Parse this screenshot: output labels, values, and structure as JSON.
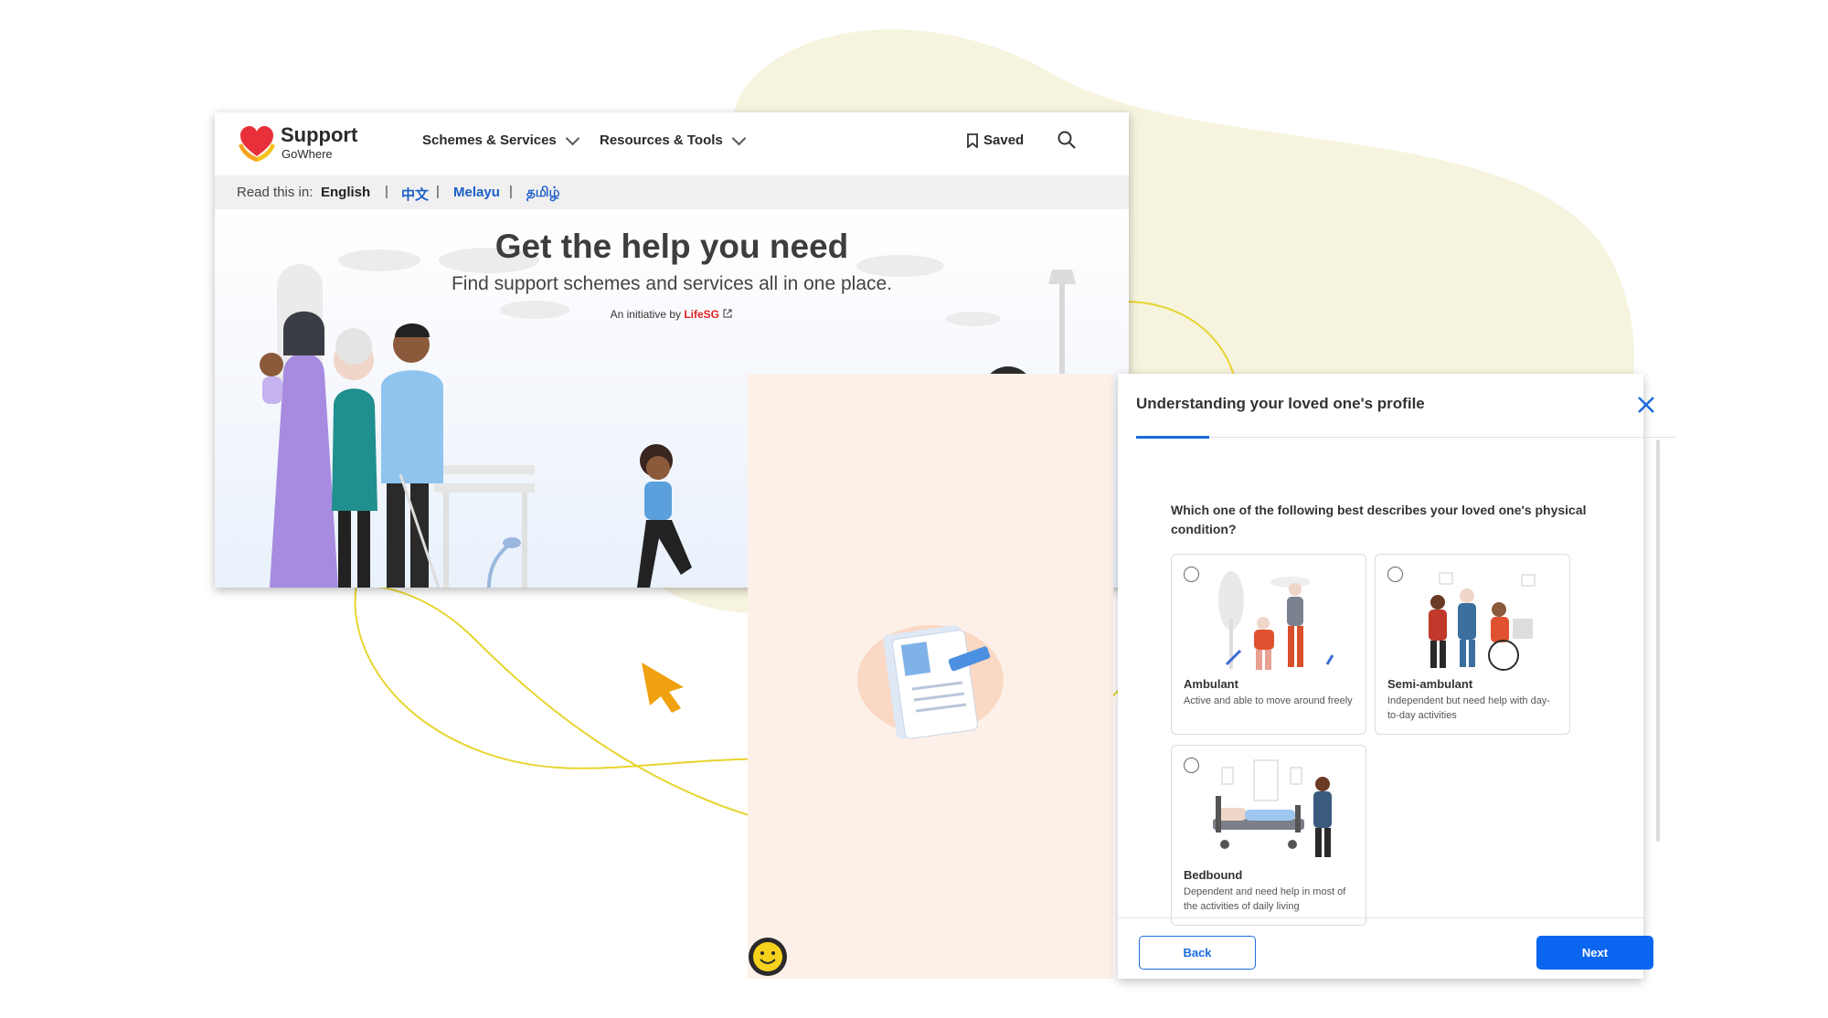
{
  "site": {
    "logo": {
      "line1": "Support",
      "line2": "GoWhere"
    },
    "nav": [
      {
        "label": "Schemes & Services"
      },
      {
        "label": "Resources & Tools"
      }
    ],
    "saved_label": "Saved",
    "language_bar": {
      "label": "Read this in:",
      "selected": "English",
      "options": [
        "中文",
        "Melayu",
        "தமிழ்"
      ]
    },
    "hero": {
      "title": "Get the help you need",
      "subtitle": "Find support schemes and services all in one place.",
      "initiative_prefix": "An initiative by",
      "initiative_brand": "LifeSG"
    }
  },
  "modal": {
    "title": "Understanding your loved one's profile",
    "question": "Which one of the following best describes your loved one's physical condition?",
    "options": [
      {
        "title": "Ambulant",
        "description": "Active and able to move around freely"
      },
      {
        "title": "Semi-ambulant",
        "description": "Independent but need help with day-to-day activities"
      },
      {
        "title": "Bedbound",
        "description": "Dependent and need help in most of the activities of daily living"
      }
    ],
    "back_label": "Back",
    "next_label": "Next"
  },
  "colors": {
    "brand_red": "#e8303a",
    "accent_blue": "#0a66f0",
    "cursor_orange": "#f0a10f",
    "blob_yellow": "#f6f4de",
    "modal_left_bg": "#fdf0e8"
  }
}
